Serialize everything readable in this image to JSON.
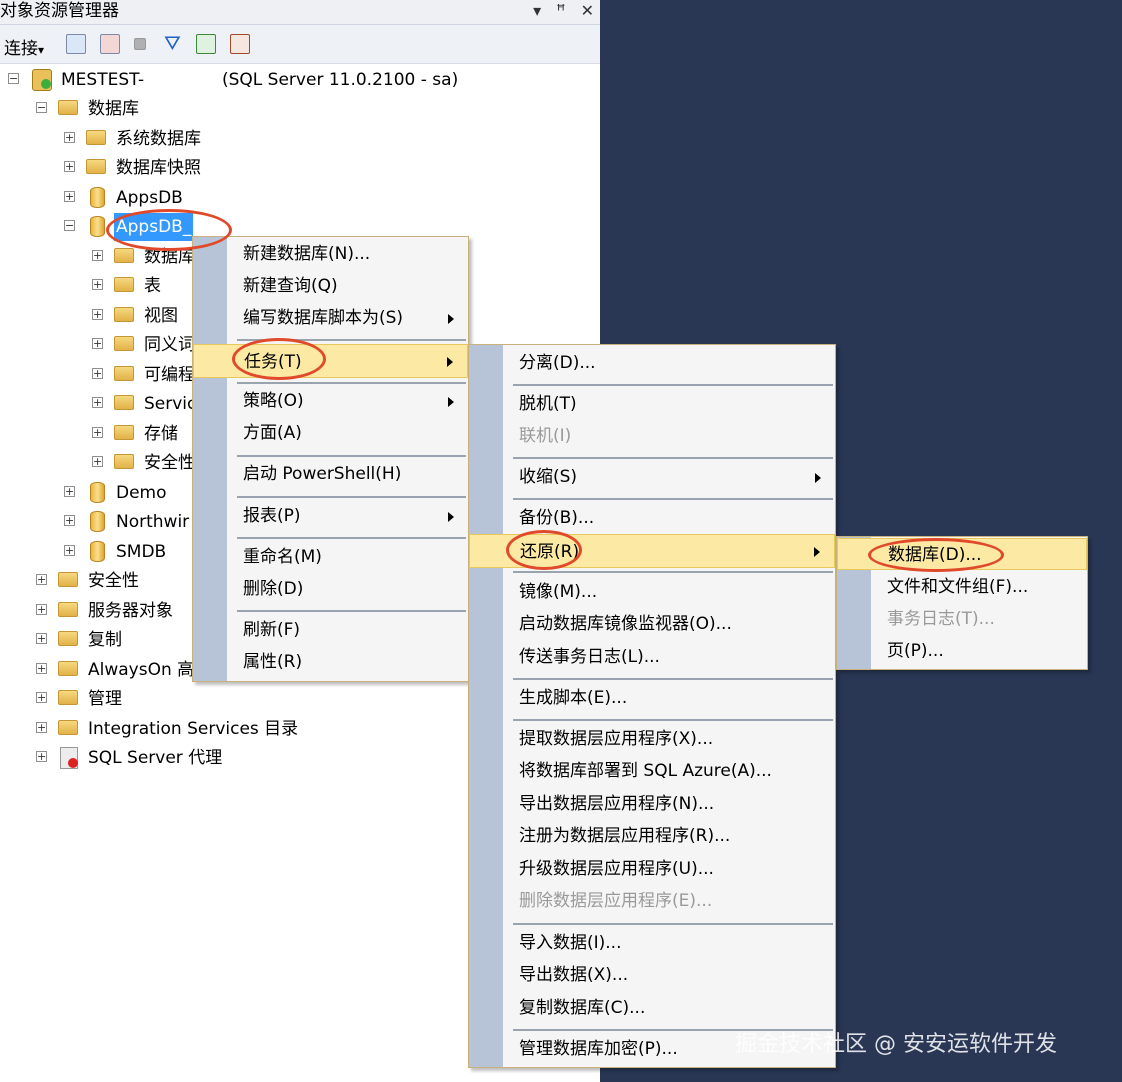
{
  "panel": {
    "title": "对象资源管理器",
    "title_buttons": [
      "▾",
      "ꟸ",
      "✕"
    ],
    "toolbar": {
      "connect_label": "连接",
      "connect_arrow": "▾",
      "icons": [
        "connect-object-explorer-icon",
        "disconnect-icon",
        "stop-icon",
        "filter-icon",
        "refresh-icon",
        "sync-icon"
      ]
    }
  },
  "tree": {
    "server_name": "MESTEST-",
    "server_info": "(SQL Server 11.0.2100 - sa)",
    "databases": "数据库",
    "system_databases": "系统数据库",
    "database_snapshots": "数据库快照",
    "appsdb_1": "AppsDB",
    "appsdb_2": "AppsDB",
    "appsdb_2_suffix": "_",
    "children": [
      "数据库",
      "表",
      "视图",
      "同义词",
      "可编程",
      "Servic",
      "存储",
      "安全性"
    ],
    "demo": "Demo",
    "northwind": "Northwir",
    "smdb": "SMDB",
    "security": "安全性",
    "server_objects": "服务器对象",
    "replication": "复制",
    "alwayson": "AlwaysOn 高",
    "management": "管理",
    "integration": "Integration Services 目录",
    "agent": "SQL Server 代理"
  },
  "context_menu": {
    "new_database": "新建数据库(N)...",
    "new_query": "新建查询(Q)",
    "script_as": "编写数据库脚本为(S)",
    "tasks": "任务(T)",
    "policies": "策略(O)",
    "facets": "方面(A)",
    "powershell": "启动 PowerShell(H)",
    "reports": "报表(P)",
    "rename": "重命名(M)",
    "delete": "删除(D)",
    "refresh": "刷新(F)",
    "properties": "属性(R)"
  },
  "tasks_menu": {
    "detach": "分离(D)...",
    "take_offline": "脱机(T)",
    "bring_online": "联机(I)",
    "shrink": "收缩(S)",
    "backup": "备份(B)...",
    "restore": "还原(R)",
    "mirror": "镜像(M)...",
    "mirror_monitor": "启动数据库镜像监视器(O)...",
    "log_shipping": "传送事务日志(L)...",
    "generate_scripts": "生成脚本(E)...",
    "extract_dac": "提取数据层应用程序(X)...",
    "deploy_azure": "将数据库部署到 SQL Azure(A)...",
    "export_dac": "导出数据层应用程序(N)...",
    "register_dac": "注册为数据层应用程序(R)...",
    "upgrade_dac": "升级数据层应用程序(U)...",
    "delete_dac": "删除数据层应用程序(E)...",
    "import_data": "导入数据(I)...",
    "export_data": "导出数据(X)...",
    "copy_database": "复制数据库(C)...",
    "manage_encryption": "管理数据库加密(P)..."
  },
  "restore_menu": {
    "database": "数据库(D)...",
    "files_filegroups": "文件和文件组(F)...",
    "transaction_log": "事务日志(T)...",
    "page": "页(P)..."
  },
  "watermark": "掘金技术社区 @ 安安运软件开发"
}
